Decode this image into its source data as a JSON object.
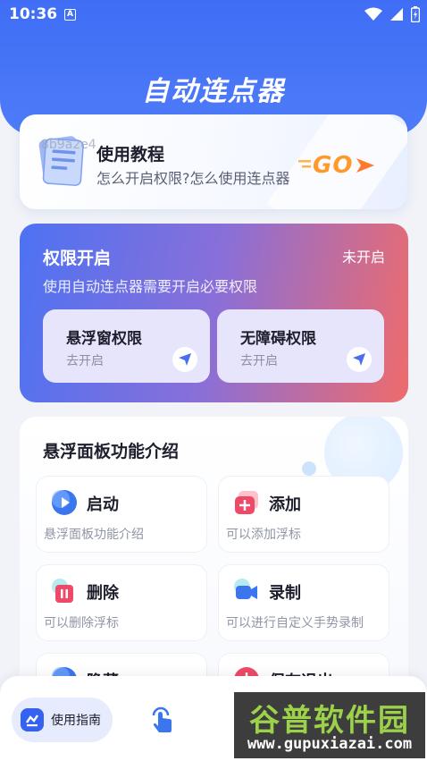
{
  "status_bar": {
    "time": "10:36",
    "notification_icon": "A"
  },
  "app": {
    "title": "自动连点器"
  },
  "tutorial": {
    "watermark": "8b9a2e4",
    "title": "使用教程",
    "subtitle": "怎么开启权限?怎么使用连点器",
    "go_label": "GO"
  },
  "permissions": {
    "title": "权限开启",
    "status": "未开启",
    "description": "使用自动连点器需要开启必要权限",
    "items": [
      {
        "title": "悬浮窗权限",
        "action": "去开启"
      },
      {
        "title": "无障碍权限",
        "action": "去开启"
      }
    ]
  },
  "features": {
    "title": "悬浮面板功能介绍",
    "items": [
      {
        "label": "启动",
        "desc": "悬浮面板功能介绍",
        "icon": "play-icon"
      },
      {
        "label": "添加",
        "desc": "可以添加浮标",
        "icon": "plus-icon"
      },
      {
        "label": "删除",
        "desc": "可以删除浮标",
        "icon": "trash-icon"
      },
      {
        "label": "录制",
        "desc": "可以进行自定义手势录制",
        "icon": "record-icon"
      },
      {
        "label": "隐藏",
        "desc": "",
        "icon": "hide-icon"
      },
      {
        "label": "保存退出",
        "desc": "",
        "icon": "power-icon"
      }
    ]
  },
  "bottom_nav": {
    "guide_label": "使用指南"
  },
  "watermark": {
    "name": "谷普软件园",
    "url": "www.gupuxiazai.com"
  }
}
